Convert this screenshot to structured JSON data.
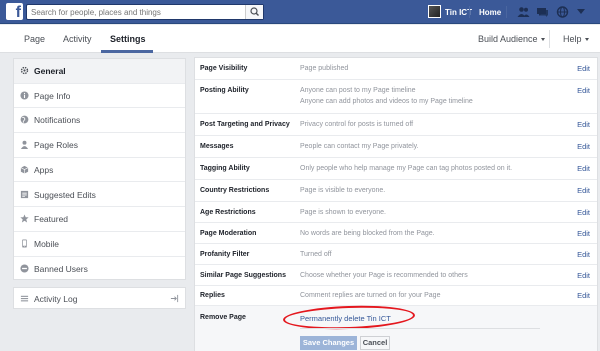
{
  "topbar": {
    "logo": "f",
    "search_placeholder": "Search for people, places and things",
    "user_name": "Tin ICT",
    "home_label": "Home",
    "icons": [
      "friend-requests-icon",
      "messages-icon",
      "notifications-icon"
    ]
  },
  "pagenav": {
    "tabs": [
      {
        "label": "Page",
        "active": false
      },
      {
        "label": "Activity",
        "active": false
      },
      {
        "label": "Settings",
        "active": true
      }
    ],
    "build_audience": "Build Audience",
    "help": "Help"
  },
  "sidebar": {
    "items": [
      {
        "label": "General",
        "icon": "gear-icon",
        "active": true
      },
      {
        "label": "Page Info",
        "icon": "info-icon",
        "active": false
      },
      {
        "label": "Notifications",
        "icon": "globe-icon",
        "active": false
      },
      {
        "label": "Page Roles",
        "icon": "person-icon",
        "active": false
      },
      {
        "label": "Apps",
        "icon": "apps-icon",
        "active": false
      },
      {
        "label": "Suggested Edits",
        "icon": "suggested-edits-icon",
        "active": false
      },
      {
        "label": "Featured",
        "icon": "star-icon",
        "active": false
      },
      {
        "label": "Mobile",
        "icon": "mobile-icon",
        "active": false
      },
      {
        "label": "Banned Users",
        "icon": "ban-icon",
        "active": false
      }
    ],
    "activity_log": "Activity Log"
  },
  "settings": {
    "edit_label": "Edit",
    "rows": [
      {
        "key": "Page Visibility",
        "value": "Page published"
      },
      {
        "key": "Posting Ability",
        "value": "Anyone can post to my Page timeline",
        "value2": "Anyone can add photos and videos to my Page timeline"
      },
      {
        "key": "Post Targeting and Privacy",
        "value": "Privacy control for posts is turned off"
      },
      {
        "key": "Messages",
        "value": "People can contact my Page privately."
      },
      {
        "key": "Tagging Ability",
        "value": "Only people who help manage my Page can tag photos posted on it."
      },
      {
        "key": "Country Restrictions",
        "value": "Page is visible to everyone."
      },
      {
        "key": "Age Restrictions",
        "value": "Page is shown to everyone."
      },
      {
        "key": "Page Moderation",
        "value": "No words are being blocked from the Page."
      },
      {
        "key": "Profanity Filter",
        "value": "Turned off"
      },
      {
        "key": "Similar Page Suggestions",
        "value": "Choose whether your Page is recommended to others"
      },
      {
        "key": "Replies",
        "value": "Comment replies are turned on for your Page"
      }
    ],
    "remove_page": {
      "key": "Remove Page",
      "link": "Permanently delete Tin ICT",
      "save": "Save Changes",
      "cancel": "Cancel"
    }
  },
  "colors": {
    "brand_blue": "#3b5998",
    "link_blue": "#365899",
    "highlight_red": "#e4171e"
  }
}
